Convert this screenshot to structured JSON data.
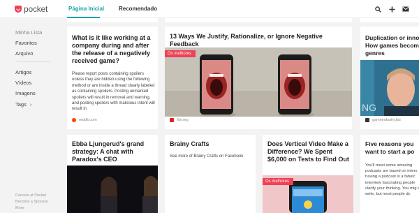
{
  "header": {
    "logo_text": "pocket",
    "tabs": [
      "Página Inicial",
      "Recomendado"
    ]
  },
  "sidebar": {
    "items": [
      "Minha Lista",
      "Favoritos",
      "Arquivo"
    ],
    "filters": [
      "Artigos",
      "Vídeos",
      "Imagens",
      "Tags"
    ],
    "footer": [
      "Careers at Pocket",
      "Become a Sponsor",
      "More"
    ]
  },
  "cards": [
    {
      "title": "What is it like working at a company during and after the release of a negatively received game?",
      "excerpt": "Please report posts containing spoilers unless they are hidden using the following method or are inside a thread clearly labeled as containing spoilers. Posting unmarked spoilers will result in removal and warning, and posting spoilers with malicious intent will result in",
      "source": "reddit.com"
    },
    {
      "title": "13 Ways We Justify, Rationalize, or Ignore Negative Feedback",
      "badge": "Os melhores",
      "source": "fibr.org"
    },
    {
      "title": "Duplication or inno How games becom genres",
      "image_caption": "NG",
      "source": "gameindustry.biz"
    },
    {
      "title": "Ebba Ljungerud's grand strategy: A chat with Paradox's CEO"
    },
    {
      "title": "Brainy Crafts",
      "excerpt": "See more of Brainy Crafts on Facebook"
    },
    {
      "title": "Does Vertical Video Make a Difference? We Spent $6,000 on Tests to Find Out",
      "badge": "Os melhores"
    },
    {
      "title": "Five reasons you want to start a po",
      "excerpt": "You'll meet some amazing podcasts are based on interv having a podcast is a fabulc interview fascinating people clarify your thinking. You mig to write, but most people dc"
    }
  ],
  "colors": {
    "accent": "#1aa3a3",
    "brand": "#ef4056",
    "background": "#f3f3f3"
  },
  "icons": [
    "search-icon",
    "plus-icon",
    "mail-icon"
  ]
}
